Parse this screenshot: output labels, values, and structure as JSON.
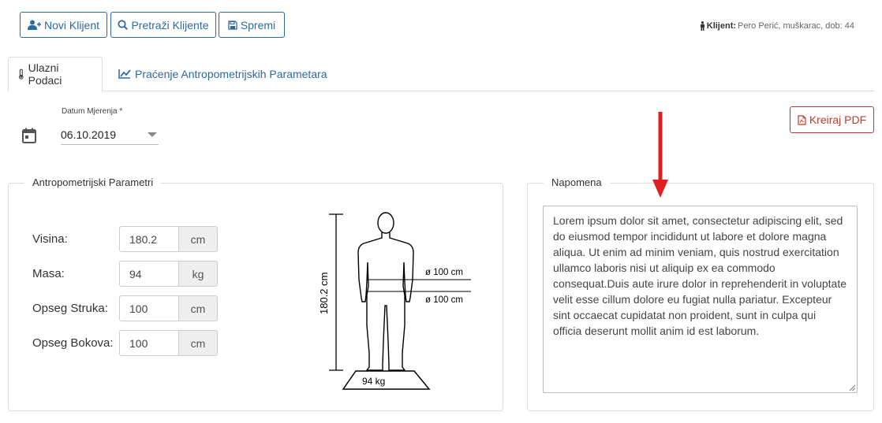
{
  "toolbar": {
    "new_client": "Novi Klijent",
    "search_clients": "Pretraži Klijente",
    "save": "Spremi"
  },
  "client": {
    "label": "Klijent:",
    "value": "Pero Perić, muškarac, dob: 44"
  },
  "tabs": [
    {
      "label": "Ulazni Podaci",
      "icon": "thermometer-icon",
      "active": true
    },
    {
      "label": "Praćenje Antropometrijskih Parametara",
      "icon": "line-chart-icon",
      "active": false
    }
  ],
  "measurement": {
    "date_label": "Datum Mjerenja *",
    "date_value": "06.10.2019"
  },
  "pdf_button": "Kreiraj PDF",
  "parameters": {
    "legend": "Antropometrijski Parametri",
    "rows": [
      {
        "label": "Visina:",
        "value": "180.2",
        "unit": "cm"
      },
      {
        "label": "Masa:",
        "value": "94",
        "unit": "kg"
      },
      {
        "label": "Opseg Struka:",
        "value": "100",
        "unit": "cm"
      },
      {
        "label": "Opseg Bokova:",
        "value": "100",
        "unit": "cm"
      }
    ]
  },
  "figure": {
    "height_text": "180.2 cm",
    "waist_text": "ø 100 cm",
    "hip_text": "ø 100 cm",
    "weight_text": "94 kg"
  },
  "note": {
    "legend": "Napomena",
    "text": "Lorem ipsum dolor sit amet, consectetur adipiscing elit, sed do eiusmod tempor incididunt ut labore et dolore magna aliqua. Ut enim ad minim veniam, quis nostrud exercitation ullamco laboris nisi ut aliquip ex ea commodo consequat.Duis aute irure dolor in reprehenderit in voluptate velit esse cillum dolore eu fugiat nulla pariatur. Excepteur sint occaecat cupidatat non proident, sunt in culpa qui officia deserunt mollit anim id est laborum."
  },
  "colors": {
    "primary": "#2d6a9f",
    "pdf": "#c0392b",
    "annotation_arrow": "#e02020"
  }
}
